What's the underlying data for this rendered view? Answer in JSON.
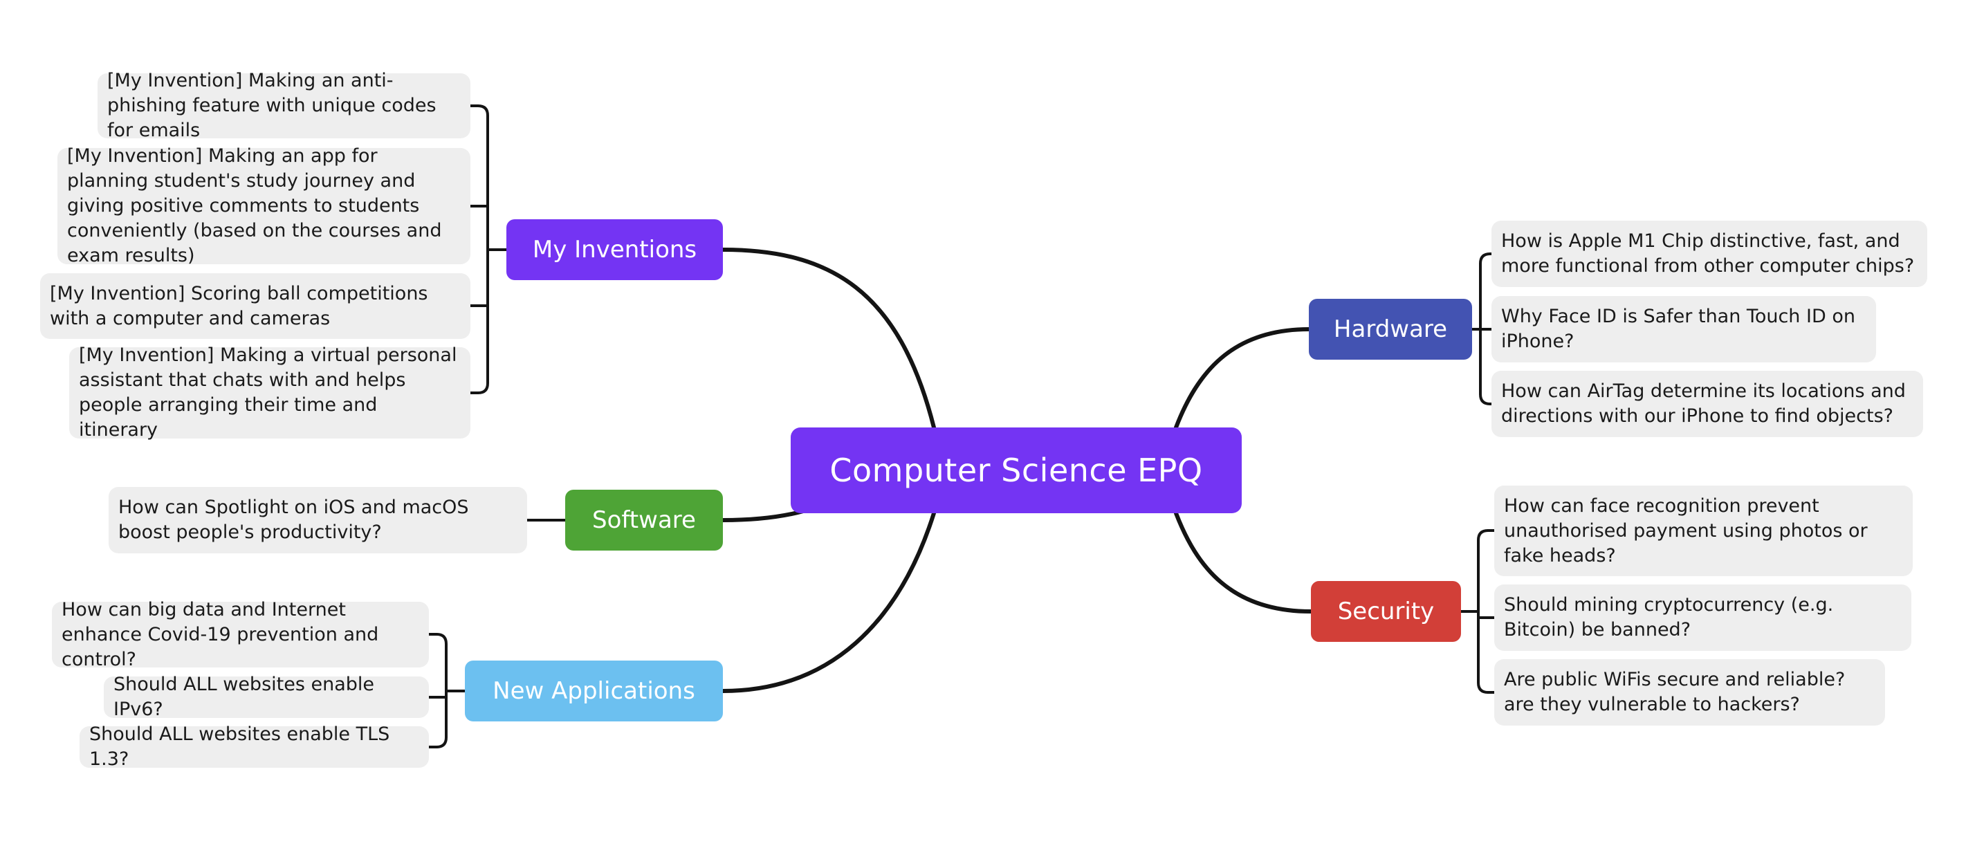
{
  "central": {
    "label": "Computer Science EPQ",
    "color": "#7434f3"
  },
  "topics": [
    {
      "id": "my-inventions",
      "label": "My Inventions",
      "color": "#7434f3",
      "side": "left",
      "children": [
        "[My Invention] Making an anti-phishing feature with unique codes for emails",
        "[My Invention] Making an app for planning student's study journey and giving positive comments to students conveniently (based on the courses and exam results)",
        "[My Invention] Scoring ball competitions with a computer and cameras",
        "[My Invention] Making a virtual personal assistant that chats with and helps people arranging their time and itinerary"
      ]
    },
    {
      "id": "software",
      "label": "Software",
      "color": "#4ea436",
      "side": "left",
      "children": [
        "How can Spotlight on iOS and macOS boost people's productivity?"
      ]
    },
    {
      "id": "new-applications",
      "label": "New Applications",
      "color": "#6cc0f0",
      "side": "left",
      "children": [
        "How can big data and Internet enhance Covid-19 prevention and control?",
        "Should ALL websites enable IPv6?",
        "Should ALL websites enable TLS 1.3?"
      ]
    },
    {
      "id": "hardware",
      "label": "Hardware",
      "color": "#4353b2",
      "side": "right",
      "children": [
        "How is Apple M1 Chip distinctive, fast, and more functional from other computer chips?",
        "Why Face ID is Safer than Touch ID on iPhone?",
        "How can AirTag determine its locations and directions with our iPhone to find objects?"
      ]
    },
    {
      "id": "security",
      "label": "Security",
      "color": "#d23f38",
      "side": "right",
      "children": [
        "How can face recognition prevent unauthorised payment using photos or fake heads?",
        "Should mining cryptocurrency (e.g. Bitcoin) be banned?",
        "Are public WiFis secure and reliable? are they vulnerable to hackers?"
      ]
    }
  ],
  "colors": {
    "leaf_bg": "#eeeeee",
    "line": "#141414",
    "text": "#1a1a1a"
  }
}
